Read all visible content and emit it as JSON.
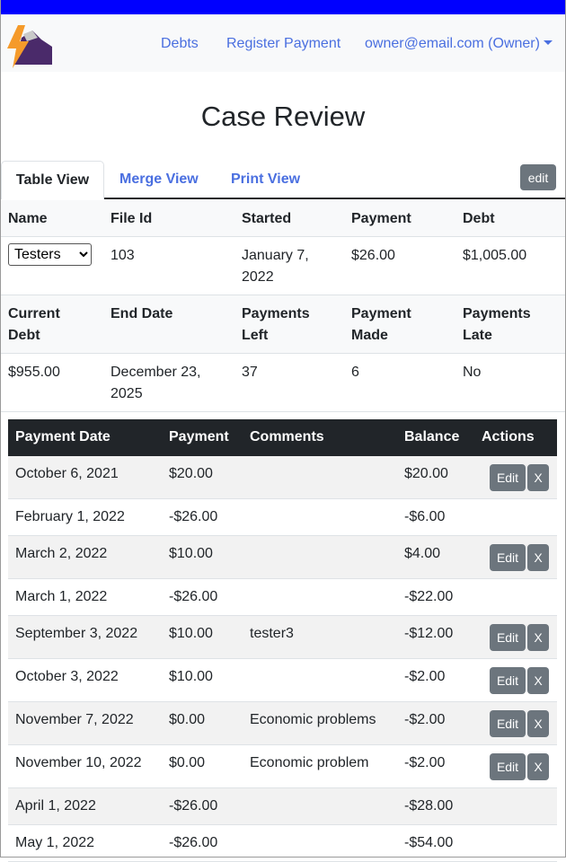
{
  "nav": {
    "debts": "Debts",
    "register_payment": "Register Payment",
    "user": "owner@email.com (Owner)"
  },
  "page_title": "Case Review",
  "tabs": {
    "table": "Table View",
    "merge": "Merge View",
    "print": "Print View",
    "edit": "edit"
  },
  "case_header_1": {
    "name": "Name",
    "file_id": "File Id",
    "started": "Started",
    "payment": "Payment",
    "debt": "Debt"
  },
  "case_values_1": {
    "name_selected": "Testers",
    "file_id": "103",
    "started_line1": "January 7,",
    "started_line2": "2022",
    "payment": "$26.00",
    "debt": "$1,005.00"
  },
  "case_header_2": {
    "current_debt_1": "Current",
    "current_debt_2": "Debt",
    "end_date": "End Date",
    "payments_left_1": "Payments",
    "payments_left_2": "Left",
    "payment_made_1": "Payment",
    "payment_made_2": "Made",
    "payments_late_1": "Payments",
    "payments_late_2": "Late"
  },
  "case_values_2": {
    "current_debt": "$955.00",
    "end_date_line1": "December 23,",
    "end_date_line2": "2025",
    "payments_left": "37",
    "payment_made": "6",
    "payments_late": "No"
  },
  "payments_table": {
    "columns": [
      "Payment Date",
      "Payment",
      "Comments",
      "Balance",
      "Actions"
    ],
    "edit_label": "Edit",
    "delete_label": "X",
    "rows": [
      {
        "date": "October 6, 2021",
        "payment": "$20.00",
        "comment": "",
        "balance": "$20.00"
      },
      {
        "date": "February 1, 2022",
        "payment": "-$26.00",
        "comment": "",
        "balance": "-$6.00"
      },
      {
        "date": "March 2, 2022",
        "payment": "$10.00",
        "comment": "",
        "balance": "$4.00"
      },
      {
        "date": "March 1, 2022",
        "payment": "-$26.00",
        "comment": "",
        "balance": "-$22.00"
      },
      {
        "date": "September 3, 2022",
        "payment": "$10.00",
        "comment": "tester3",
        "balance": "-$12.00"
      },
      {
        "date": "October 3, 2022",
        "payment": "$10.00",
        "comment": "",
        "balance": "-$2.00"
      },
      {
        "date": "November 7, 2022",
        "payment": "$0.00",
        "comment": "Economic problems",
        "balance": "-$2.00"
      },
      {
        "date": "November 10, 2022",
        "payment": "$0.00",
        "comment": "Economic problem",
        "balance": "-$2.00"
      },
      {
        "date": "April 1, 2022",
        "payment": "-$26.00",
        "comment": "",
        "balance": "-$28.00"
      },
      {
        "date": "May 1, 2022",
        "payment": "-$26.00",
        "comment": "",
        "balance": "-$54.00"
      }
    ]
  },
  "colors": {
    "top_bar": "#0000ff",
    "link": "#4a6fe0",
    "table_head": "#212529",
    "button": "#6c757d"
  }
}
